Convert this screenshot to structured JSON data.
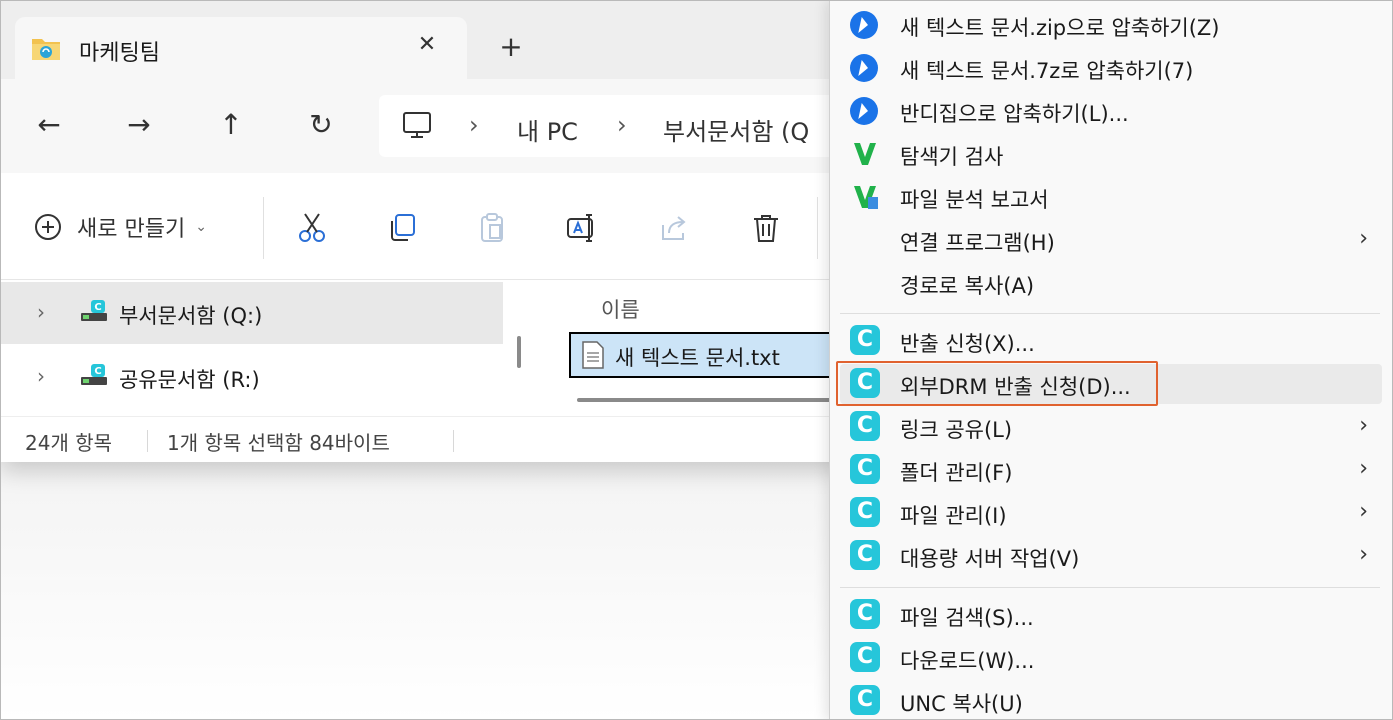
{
  "window": {
    "tab_title": "마케팅팀",
    "tab_close_glyph": "✕",
    "new_tab_glyph": "+"
  },
  "nav": {
    "back_glyph": "←",
    "forward_glyph": "→",
    "up_glyph": "↑",
    "refresh_glyph": "↻",
    "breadcrumb_sep": "›",
    "breadcrumbs": [
      "내 PC",
      "부서문서함 (Q"
    ]
  },
  "toolbar": {
    "new_label": "새로 만들기",
    "new_caret": "⌄",
    "icons": [
      "cut-icon",
      "copy-icon",
      "paste-icon",
      "rename-icon",
      "share-icon",
      "delete-icon"
    ]
  },
  "tree": {
    "chevron": "›",
    "items": [
      {
        "label": "부서문서함 (Q:)",
        "selected": true
      },
      {
        "label": "공유문서함 (R:)",
        "selected": false
      }
    ]
  },
  "files": {
    "column_name": "이름",
    "selected_file": "새 텍스트 문서.txt"
  },
  "status": {
    "count": "24개 항목",
    "selection": "1개 항목 선택함 84바이트"
  },
  "menu": {
    "submenu_arrow": "›",
    "items": [
      {
        "label": "새 텍스트 문서.zip으로 압축하기(Z)",
        "icon": "bandizip-icon"
      },
      {
        "label": "새 텍스트 문서.7z로 압축하기(7)",
        "icon": "bandizip-icon"
      },
      {
        "label": "반디집으로 압축하기(L)...",
        "icon": "bandizip-icon"
      },
      {
        "label": "탐색기 검사",
        "icon": "v3-icon"
      },
      {
        "label": "파일 분석 보고서",
        "icon": "v3-report-icon"
      },
      {
        "label": "연결 프로그램(H)",
        "icon": ""
      },
      {
        "label": "경로로 복사(A)",
        "icon": ""
      },
      {
        "label": "반출 신청(X)...",
        "icon": "c-app-icon"
      },
      {
        "label": "외부DRM 반출 신청(D)...",
        "icon": "c-app-icon"
      },
      {
        "label": "링크 공유(L)",
        "icon": "c-app-icon"
      },
      {
        "label": "폴더 관리(F)",
        "icon": "c-app-icon"
      },
      {
        "label": "파일 관리(I)",
        "icon": "c-app-icon"
      },
      {
        "label": "대용량 서버 작업(V)",
        "icon": "c-app-icon"
      },
      {
        "label": "파일 검색(S)...",
        "icon": "c-app-icon"
      },
      {
        "label": "다운로드(W)...",
        "icon": "c-app-icon"
      },
      {
        "label": "UNC 복사(U)",
        "icon": "c-app-icon"
      }
    ],
    "badge_letter": "C",
    "colors": {
      "highlight_border": "#e0622f",
      "c_badge": "#26c6da",
      "bandizip": "#1a73e8",
      "v3": "#21b24b"
    }
  }
}
